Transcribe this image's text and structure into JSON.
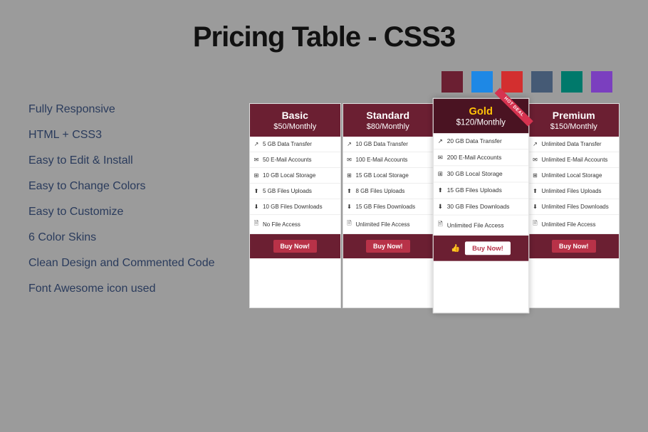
{
  "title": "Pricing Table - CSS3",
  "swatches": [
    "#6b1f32",
    "#1e88e5",
    "#d32f2f",
    "#455a75",
    "#00796b",
    "#7b3fbf"
  ],
  "features": [
    "Fully Responsive",
    "HTML + CSS3",
    "Easy to Edit & Install",
    "Easy to Change Colors",
    "Easy to Customize",
    "6 Color Skins",
    "Clean Design and Commented Code",
    "Font Awesome icon used"
  ],
  "plans": [
    {
      "name": "Basic",
      "price": "$50/Monthly",
      "featured": false,
      "ribbon": null,
      "items": [
        {
          "icon": "↗",
          "text": "5 GB Data Transfer"
        },
        {
          "icon": "✉",
          "text": "50 E-Mail Accounts"
        },
        {
          "icon": "⊞",
          "text": "10 GB Local Storage"
        },
        {
          "icon": "⬆",
          "text": "5 GB Files Uploads"
        },
        {
          "icon": "⬇",
          "text": "10 GB Files Downloads"
        },
        {
          "icon": "🗎",
          "text": "No File Access"
        }
      ],
      "button": "Buy Now!"
    },
    {
      "name": "Standard",
      "price": "$80/Monthly",
      "featured": false,
      "ribbon": null,
      "items": [
        {
          "icon": "↗",
          "text": "10 GB Data Transfer"
        },
        {
          "icon": "✉",
          "text": "100 E-Mail Accounts"
        },
        {
          "icon": "⊞",
          "text": "15 GB Local Storage"
        },
        {
          "icon": "⬆",
          "text": "8 GB Files Uploads"
        },
        {
          "icon": "⬇",
          "text": "15 GB Files Downloads"
        },
        {
          "icon": "🗎",
          "text": "Unlimited File Access"
        }
      ],
      "button": "Buy Now!"
    },
    {
      "name": "Gold",
      "price": "$120/Monthly",
      "featured": true,
      "ribbon": "HOT DEAL",
      "items": [
        {
          "icon": "↗",
          "text": "20 GB Data Transfer"
        },
        {
          "icon": "✉",
          "text": "200 E-Mail Accounts"
        },
        {
          "icon": "⊞",
          "text": "30 GB Local Storage"
        },
        {
          "icon": "⬆",
          "text": "15 GB Files Uploads"
        },
        {
          "icon": "⬇",
          "text": "30 GB Files Downloads"
        },
        {
          "icon": "🗎",
          "text": "Unlimited File Access"
        }
      ],
      "button": "Buy Now!"
    },
    {
      "name": "Premium",
      "price": "$150/Monthly",
      "featured": false,
      "ribbon": null,
      "items": [
        {
          "icon": "↗",
          "text": "Unlimited Data Transfer"
        },
        {
          "icon": "✉",
          "text": "Unlimited E-Mail Accounts"
        },
        {
          "icon": "⊞",
          "text": "Unlimited Local Storage"
        },
        {
          "icon": "⬆",
          "text": "Unlimited Files Uploads"
        },
        {
          "icon": "⬇",
          "text": "Unlimited Files Downloads"
        },
        {
          "icon": "🗎",
          "text": "Unlimited File Access"
        }
      ],
      "button": "Buy Now!"
    }
  ]
}
